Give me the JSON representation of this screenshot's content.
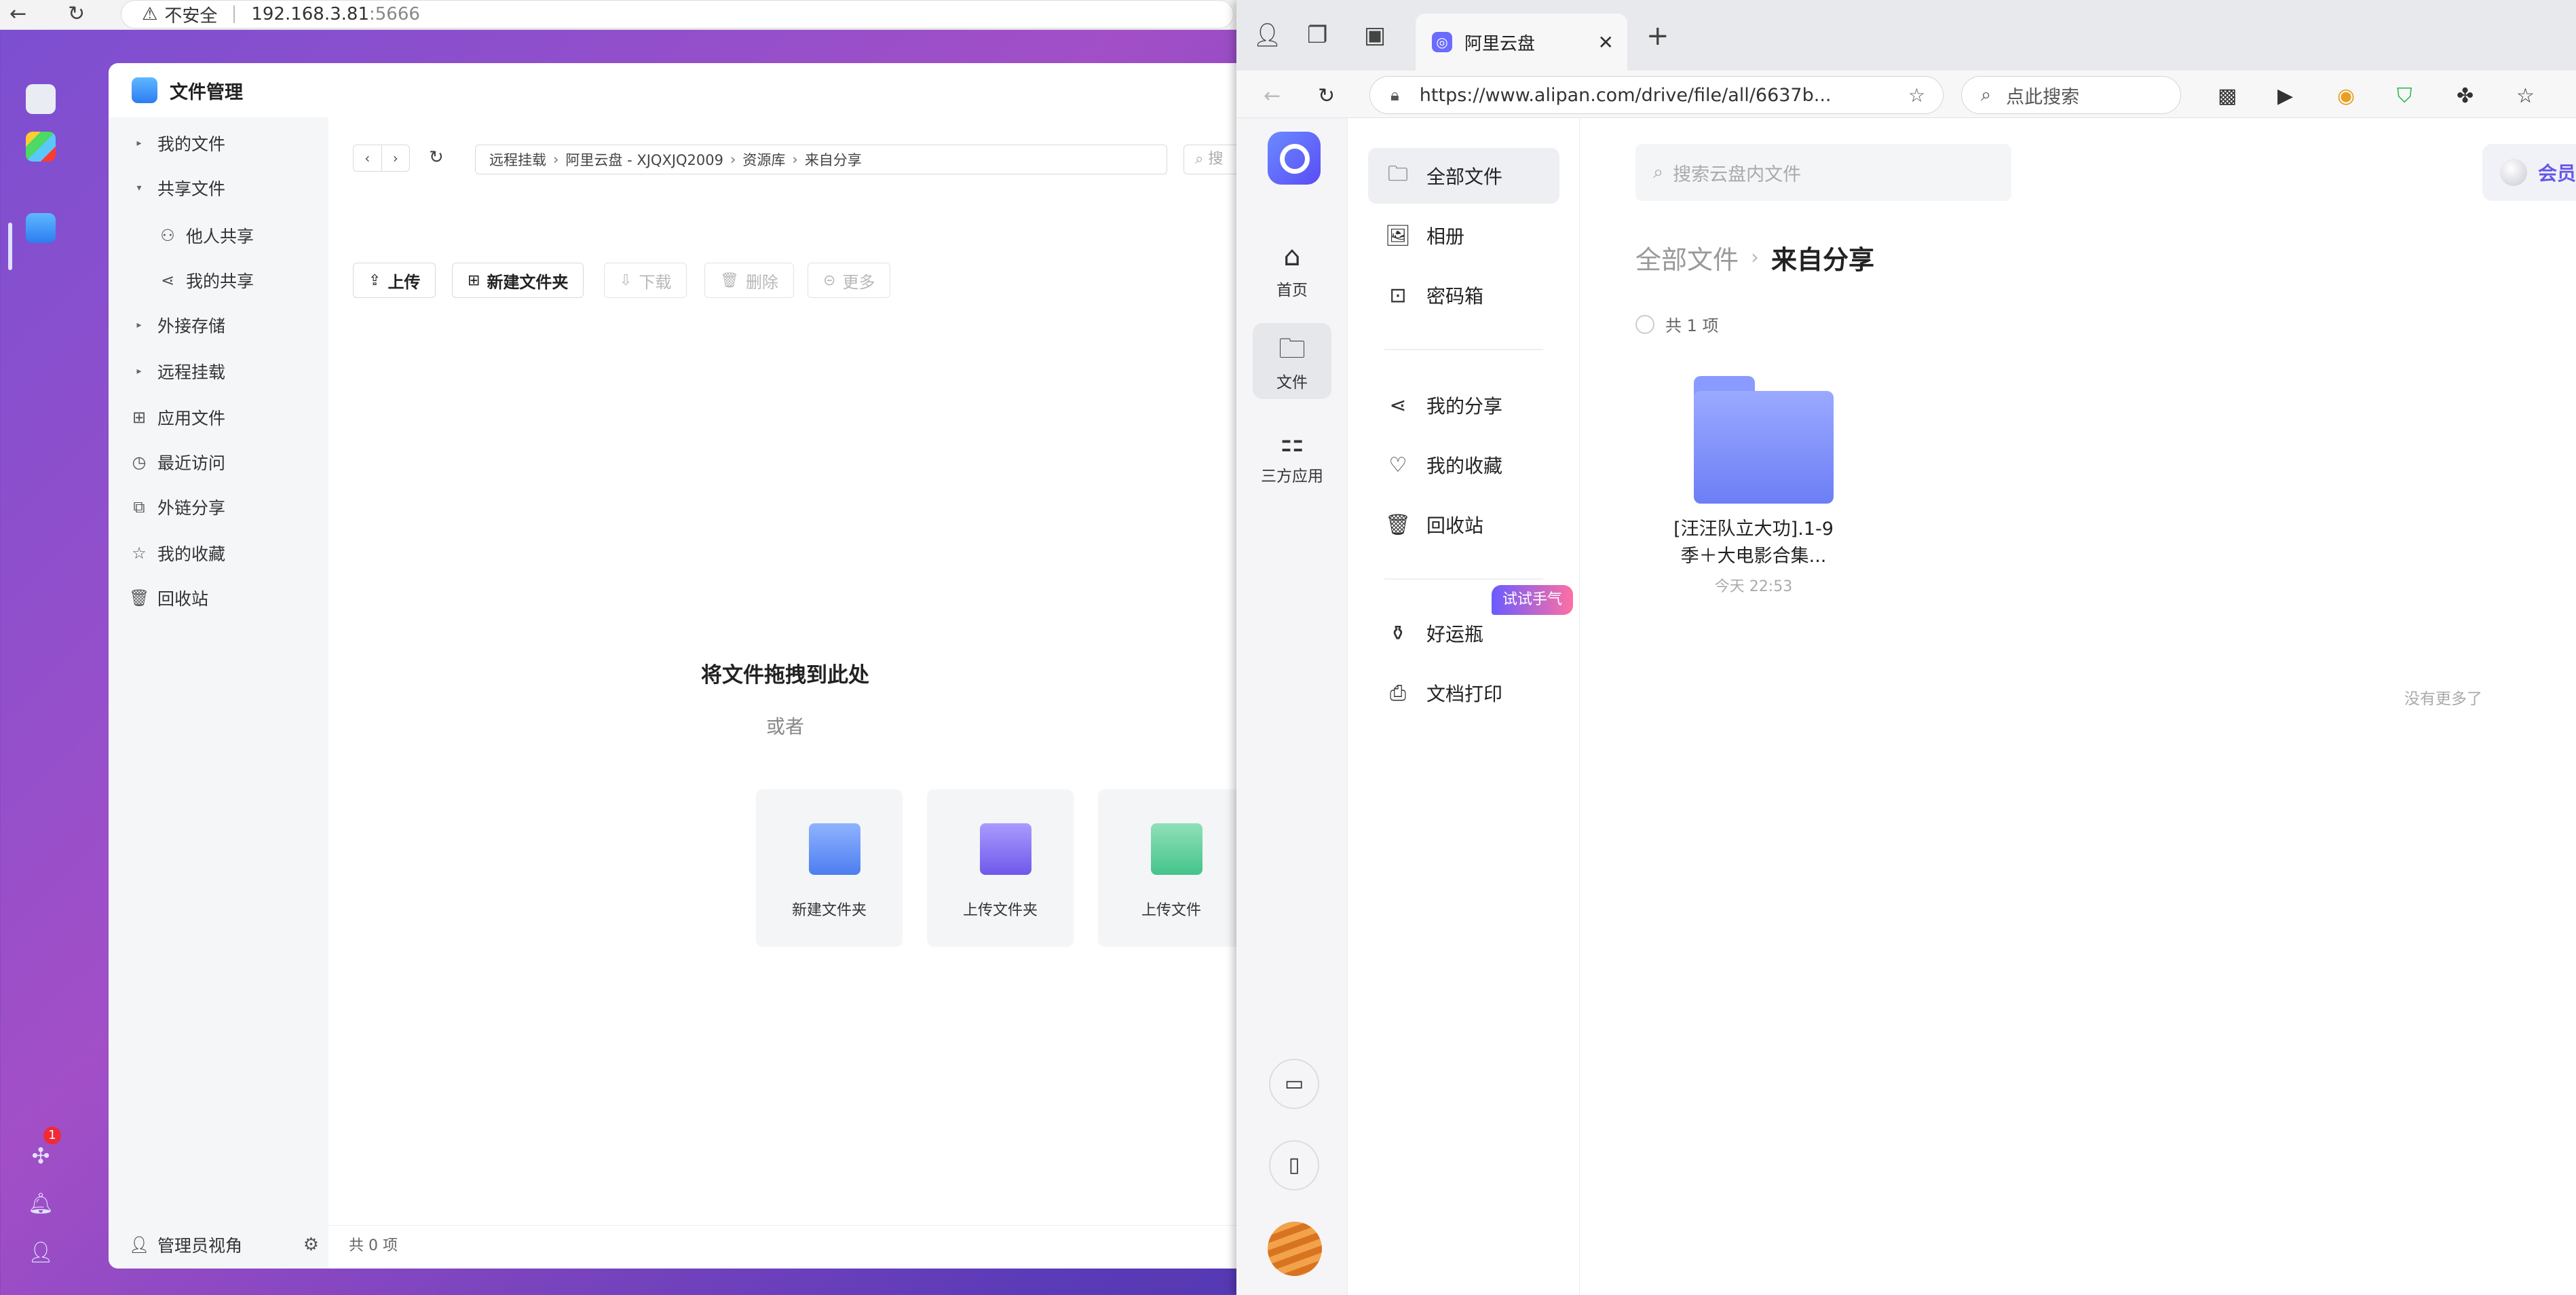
{
  "left_browser": {
    "warning": "不安全",
    "url_host": "192.168.3.81",
    "url_port": ":5666"
  },
  "dock": {
    "notification_count": "1"
  },
  "file_manager": {
    "title": "文件管理",
    "sidebar": {
      "my_files": "我的文件",
      "shared_files": "共享文件",
      "others_share": "他人共享",
      "my_share": "我的共享",
      "external_storage": "外接存储",
      "remote_mount": "远程挂载",
      "app_files": "应用文件",
      "recent": "最近访问",
      "link_share": "外链分享",
      "favorites": "我的收藏",
      "recycle": "回收站",
      "admin_view": "管理员视角"
    },
    "breadcrumb": [
      "远程挂载",
      "阿里云盘 - XJQXJQ2009",
      "资源库",
      "来自分享"
    ],
    "search_placeholder": "搜",
    "toolbar": {
      "upload": "上传",
      "new_folder": "新建文件夹",
      "download": "下载",
      "delete": "删除",
      "more": "更多"
    },
    "drop_title": "将文件拖拽到此处",
    "drop_or": "或者",
    "cards": {
      "new_folder": "新建文件夹",
      "upload_folder": "上传文件夹",
      "upload_file": "上传文件"
    },
    "footer": "共 0 项"
  },
  "right_browser": {
    "tab_title": "阿里云盘",
    "url": "https://www.alipan.com/drive/file/all/6637b...",
    "search_placeholder": "点此搜索"
  },
  "alipan": {
    "rail": {
      "home": "首页",
      "files": "文件",
      "apps": "三方应用"
    },
    "nav": {
      "all_files": "全部文件",
      "album": "相册",
      "safe": "密码箱",
      "my_share": "我的分享",
      "favorites": "我的收藏",
      "recycle": "回收站",
      "lucky_bottle": "好运瓶",
      "lucky_tag": "试试手气",
      "print": "文档打印"
    },
    "search_placeholder": "搜索云盘内文件",
    "vip": "会员",
    "crumb_parent": "全部文件",
    "crumb_current": "来自分享",
    "count": "共 1 项",
    "folder": {
      "name_line1": "[汪汪队立大功].1-9",
      "name_line2": "季＋大电影合集...",
      "time": "今天 22:53"
    },
    "no_more": "没有更多了"
  }
}
